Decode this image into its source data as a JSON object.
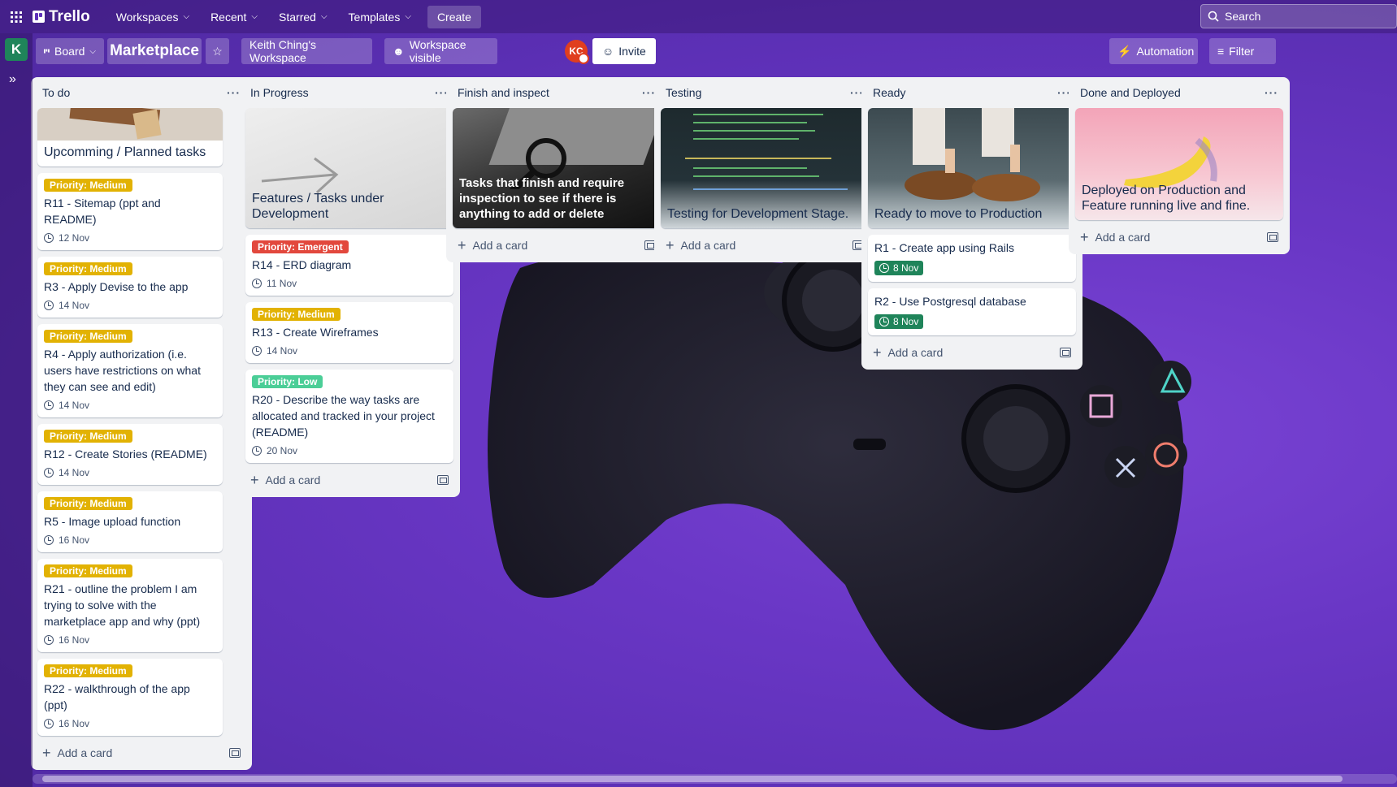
{
  "colors": {
    "priority_medium": "#e2b203",
    "priority_emergent": "#e2483d",
    "priority_low": "#4bce97",
    "date_done": "#1f845a"
  },
  "topnav": {
    "logo": "Trello",
    "items": [
      "Workspaces",
      "Recent",
      "Starred",
      "Templates"
    ],
    "create": "Create",
    "search_placeholder": "Search"
  },
  "rail": {
    "workspace_initial": "K"
  },
  "header": {
    "view": "Board",
    "board_title": "Marketplace",
    "workspace": "Keith Ching's Workspace",
    "visibility": "Workspace visible",
    "avatar": "KC",
    "invite": "Invite",
    "automation": "Automation",
    "filter": "Filter"
  },
  "lists": [
    {
      "title": "To do",
      "cover": "Upcomming / Planned tasks",
      "add_card": "Add a card",
      "cards": [
        {
          "label": "Priority: Medium",
          "title": "R11 - Sitemap (ppt and README)",
          "date": "12 Nov"
        },
        {
          "label": "Priority: Medium",
          "title": "R3 - Apply Devise to the app",
          "date": "14 Nov"
        },
        {
          "label": "Priority: Medium",
          "title": "R4 - Apply authorization (i.e. users have restrictions on what they can see and edit)",
          "date": "14 Nov"
        },
        {
          "label": "Priority: Medium",
          "title": "R12 - Create Stories (README)",
          "date": "14 Nov"
        },
        {
          "label": "Priority: Medium",
          "title": "R5 - Image upload function",
          "date": "16 Nov"
        },
        {
          "label": "Priority: Medium",
          "title": "R21 - outline the problem I am trying to solve with the marketplace app and why (ppt)",
          "date": "16 Nov"
        },
        {
          "label": "Priority: Medium",
          "title": "R22 - walkthrough of the app (ppt)",
          "date": "16 Nov"
        }
      ]
    },
    {
      "title": "In Progress",
      "cover": "Features / Tasks under Development",
      "add_card": "Add a card",
      "cards": [
        {
          "label": "Priority: Emergent",
          "title": "R14 - ERD diagram",
          "date": "11 Nov"
        },
        {
          "label": "Priority: Medium",
          "title": "R13 - Create Wireframes",
          "date": "14 Nov"
        },
        {
          "label": "Priority: Low",
          "title": "R20 - Describe the way tasks are allocated and tracked in your project (README)",
          "date": "20 Nov"
        }
      ]
    },
    {
      "title": "Finish and inspect",
      "cover": "Tasks that finish and require inspection to see if there is anything to add or delete",
      "add_card": "Add a card"
    },
    {
      "title": "Testing",
      "cover": "Testing for Development Stage.",
      "add_card": "Add a card"
    },
    {
      "title": "Ready",
      "cover": "Ready to move to Production",
      "add_card": "Add a card",
      "cards": [
        {
          "title": "R1 - Create app using Rails",
          "date": "8 Nov"
        },
        {
          "title": "R2 - Use Postgresql database",
          "date": "8 Nov"
        }
      ]
    },
    {
      "title": "Done and Deployed",
      "cover": "Deployed on Production and Feature running live and fine.",
      "add_card": "Add a card"
    }
  ]
}
